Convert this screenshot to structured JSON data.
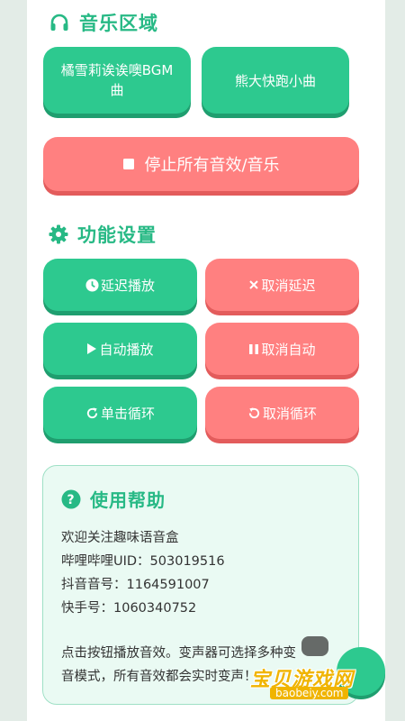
{
  "music_section": {
    "title": "音乐区域",
    "icon": "headphones-icon",
    "buttons": [
      {
        "line1": "橘雪莉诶诶噢BGM",
        "line2": "曲"
      },
      {
        "line1": "熊大快跑小曲",
        "line2": ""
      }
    ],
    "stop_button": "停止所有音效/音乐"
  },
  "function_section": {
    "title": "功能设置",
    "icon": "gear-icon",
    "buttons": {
      "delay_play": "延迟播放",
      "cancel_delay": "取消延迟",
      "auto_play": "自动播放",
      "cancel_auto": "取消自动",
      "single_loop": "单击循环",
      "cancel_loop": "取消循环"
    }
  },
  "help": {
    "title": "使用帮助",
    "icon": "question-circle-icon",
    "lines": [
      "欢迎关注趣味语音盒",
      "哔哩哔哩UID：503019516",
      "抖音音号：1164591007",
      "快手号：1060340752",
      "",
      "点击按钮播放音效。变声器可选择多种变",
      "音模式，所有音效都会实时变声！"
    ]
  },
  "watermark": {
    "text": "宝贝游戏网",
    "sub": "baobeiy.com"
  },
  "colors": {
    "accent_green": "#2dc98f",
    "title_green": "#27b985",
    "button_red": "#ff8080",
    "background": "#e3ece7"
  }
}
